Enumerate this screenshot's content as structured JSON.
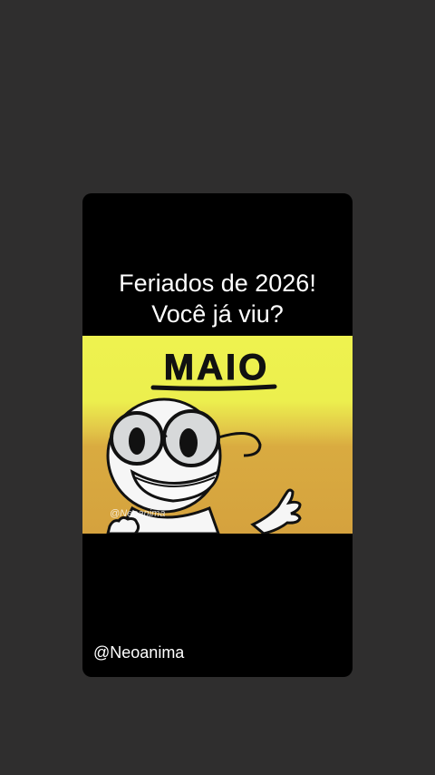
{
  "post": {
    "title_line1": "Feriados de 2026!",
    "title_line2": "Você já viu?",
    "thumbnail_text": "MAIO",
    "watermark": "@Neoanima",
    "author_handle": "@Neoanima"
  },
  "colors": {
    "background": "#2f2e2e",
    "card": "#000000",
    "thumb_top": "#f0f552",
    "thumb_bottom": "#d7a63f"
  }
}
